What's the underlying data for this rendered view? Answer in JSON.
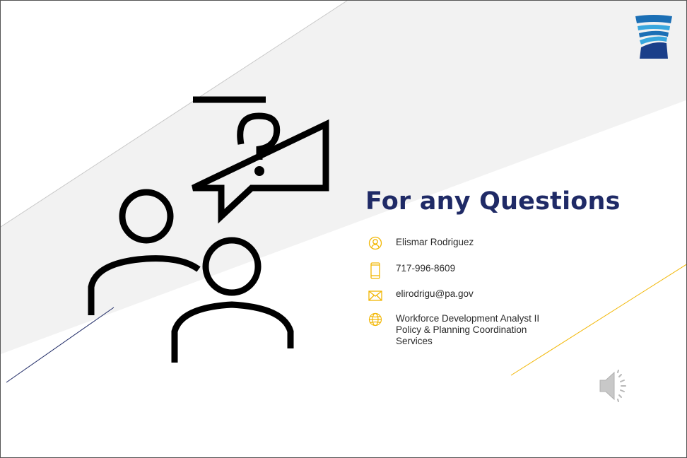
{
  "slide": {
    "title": "For any Questions",
    "colors": {
      "title": "#1f2a66",
      "accent_gold": "#f2b705",
      "gray_band": "#f2f2f2",
      "line_navy": "#1f2a66"
    }
  },
  "contact": {
    "name": "Elismar Rodriguez",
    "phone": "717-996-8609",
    "email": "elirodrigu@pa.gov",
    "role_lines": [
      "Workforce Development Analyst II",
      "Policy & Planning Coordination",
      "Services"
    ]
  },
  "icons": {
    "logo": "keystone-logo",
    "illustration": "people-question-icon",
    "person": "person-icon",
    "phone": "phone-icon",
    "email": "mail-icon",
    "web": "globe-icon",
    "audio": "speaker-icon"
  }
}
